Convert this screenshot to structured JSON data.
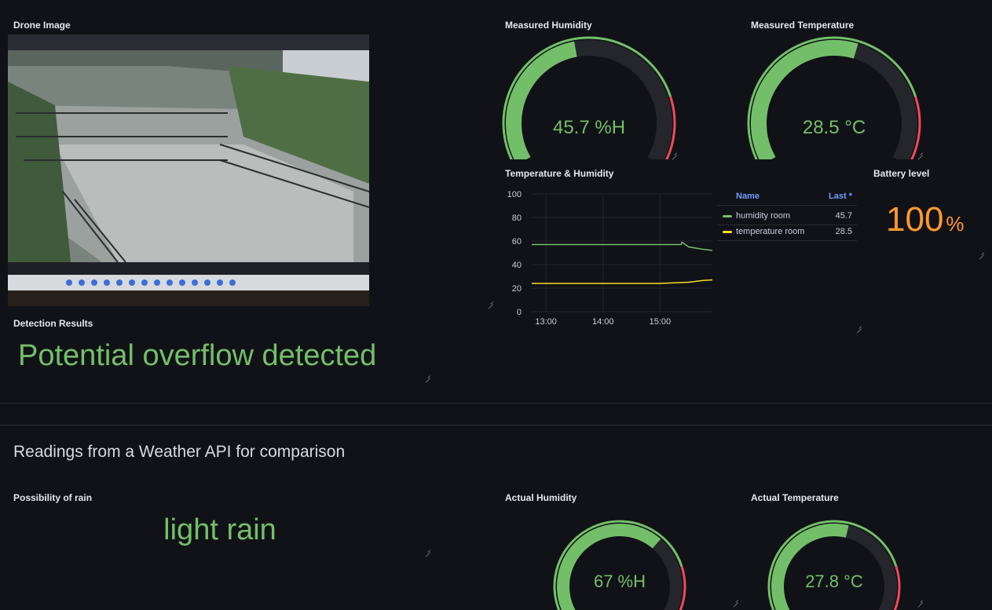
{
  "drone_panel": {
    "title": "Drone Image"
  },
  "detection_panel": {
    "title": "Detection Results",
    "text": "Potential overflow detected"
  },
  "humidity_panel": {
    "title": "Measured Humidity",
    "value": 45.7,
    "display": "45.7 %H",
    "min": 0,
    "max": 100
  },
  "temperature_panel": {
    "title": "Measured Temperature",
    "value": 28.5,
    "display": "28.5 °C",
    "min": 0,
    "max": 50
  },
  "timeseries_panel": {
    "title": "Temperature & Humidity",
    "legend": {
      "name_header": "Name",
      "last_header": "Last *",
      "rows": [
        {
          "name": "humidity room",
          "last": "45.7",
          "color": "#73bf69"
        },
        {
          "name": "temperature room",
          "last": "28.5",
          "color": "#fade2a"
        }
      ]
    }
  },
  "battery_panel": {
    "title": "Battery level",
    "value": "100",
    "unit": "%",
    "color": "#ff9830"
  },
  "weather_row": {
    "title": "Readings from a Weather API for comparison"
  },
  "rain_panel": {
    "title": "Possibility of rain",
    "text": "light rain"
  },
  "actual_humidity_panel": {
    "title": "Actual Humidity",
    "value": 67,
    "display": "67 %H",
    "min": 0,
    "max": 100
  },
  "actual_temperature_panel": {
    "title": "Actual Temperature",
    "value": 27.8,
    "display": "27.8 °C",
    "min": 0,
    "max": 50
  },
  "colors": {
    "green": "#73bf69",
    "yellow": "#fade2a",
    "red": "#f2495c",
    "orange": "#ff9830",
    "track": "#25262c"
  },
  "chart_data": {
    "type": "line",
    "x_ticks": [
      "13:00",
      "14:00",
      "15:00"
    ],
    "ylim": [
      0,
      100
    ],
    "y_ticks": [
      0,
      20,
      40,
      60,
      80,
      100
    ],
    "grid": true,
    "legend_placement": "right",
    "series": [
      {
        "name": "humidity room",
        "color": "#73bf69",
        "x": [
          "12:45",
          "13:00",
          "13:30",
          "14:00",
          "14:30",
          "15:00",
          "15:22",
          "15:23",
          "15:30",
          "15:45",
          "15:55"
        ],
        "values": [
          57,
          57,
          57,
          57,
          57,
          57,
          57,
          59,
          55,
          53,
          52
        ]
      },
      {
        "name": "temperature room",
        "color": "#fade2a",
        "x": [
          "12:45",
          "13:00",
          "13:30",
          "14:00",
          "14:30",
          "15:00",
          "15:30",
          "15:45",
          "15:55"
        ],
        "values": [
          24,
          24,
          24,
          24,
          24,
          24,
          25,
          26.5,
          27
        ]
      }
    ]
  }
}
